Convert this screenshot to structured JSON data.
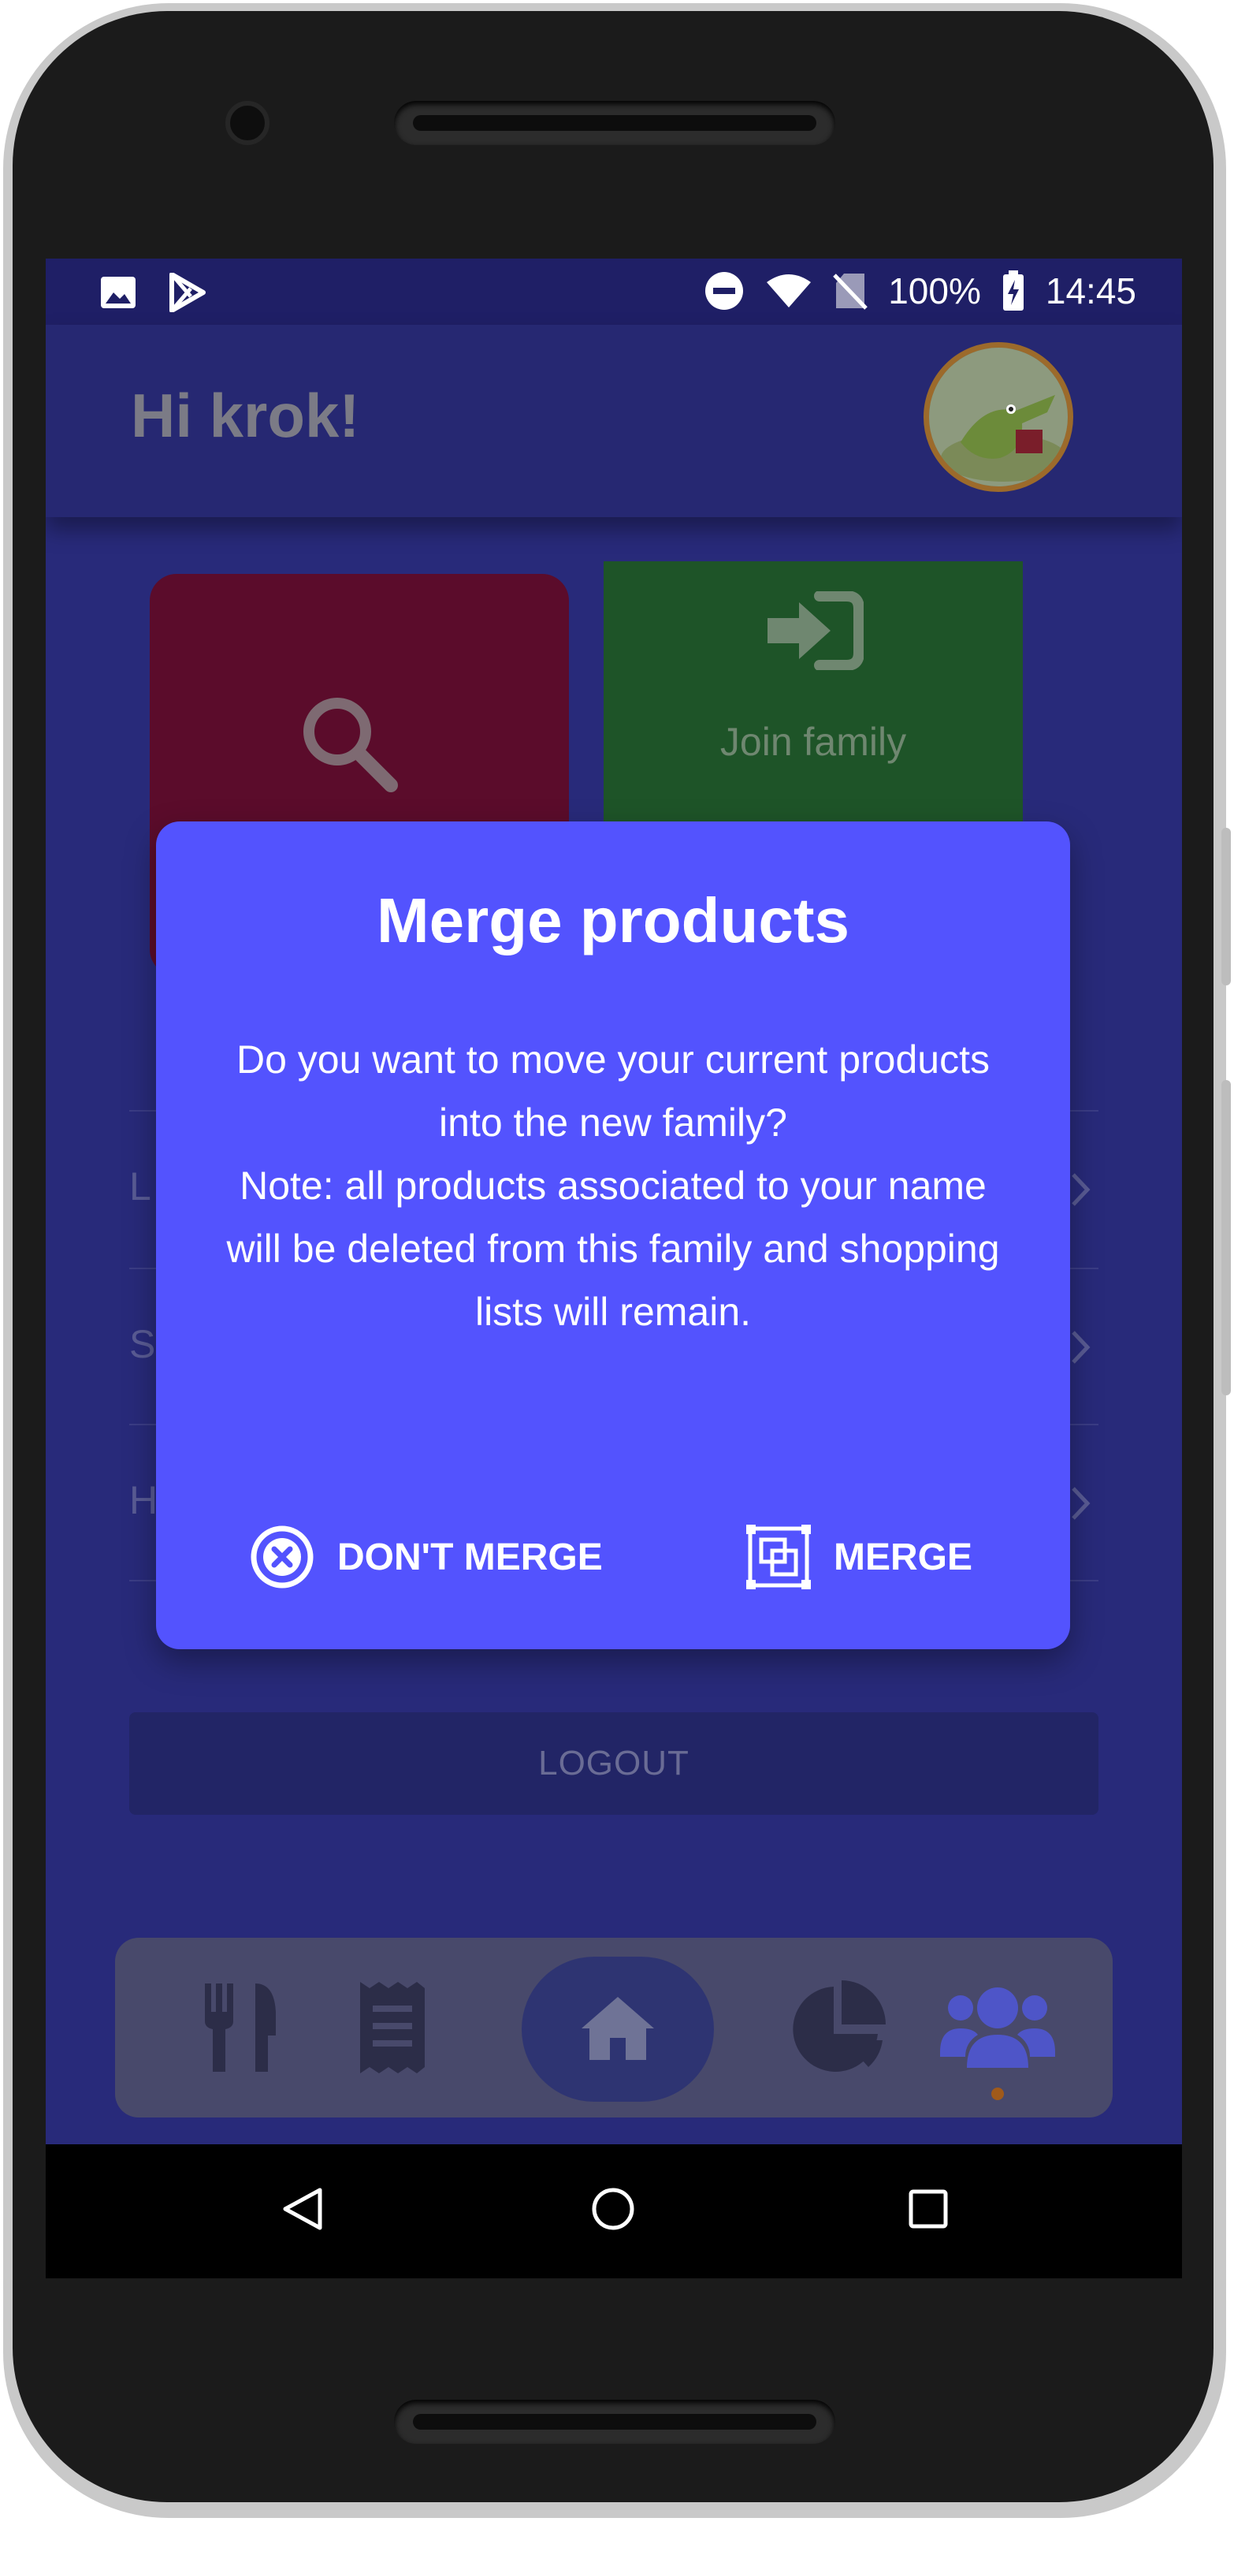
{
  "status_bar": {
    "battery": "100%",
    "time": "14:45",
    "icons": [
      "image-icon",
      "play-store-icon",
      "do-not-disturb-icon",
      "wifi-icon",
      "no-sim-icon",
      "battery-charging-icon"
    ]
  },
  "header": {
    "greeting": "Hi krok!",
    "avatar": "crocodile-avatar"
  },
  "tiles": {
    "search_icon": "search-icon",
    "join_label": "Join family",
    "join_icon": "sign-in-icon"
  },
  "menu_fragments": [
    "L",
    "S",
    "H"
  ],
  "logout_label": "LOGOUT",
  "bottom_nav": {
    "items": [
      "utensils-icon",
      "receipt-icon",
      "home-icon",
      "pie-chart-icon",
      "users-icon"
    ],
    "active": "users-icon",
    "indicator_color": "#a05a1a"
  },
  "dialog": {
    "title": "Merge products",
    "body": "Do you want to move your current products into the new family?",
    "note": "Note: all products associated to your name will be deleted from this family and shopping lists will remain.",
    "dont_merge_label": "DON'T MERGE",
    "merge_label": "MERGE"
  },
  "colors": {
    "dialog_bg": "#5353fe",
    "screen_bg": "#282a7a",
    "tile_search": "#5b0c2b",
    "tile_join": "#1e5428"
  }
}
